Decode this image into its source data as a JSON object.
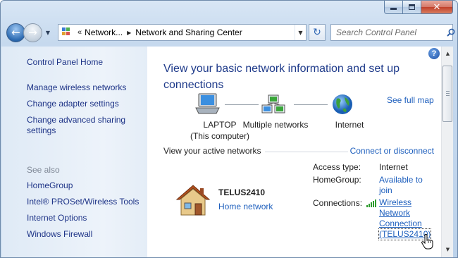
{
  "window": {
    "minimize_glyph": "minimize",
    "maximize_glyph": "maximize",
    "close_glyph": "✕"
  },
  "nav": {
    "back_glyph": "←",
    "forward_glyph": "→",
    "history_glyph": "▼"
  },
  "address": {
    "chevron": "«",
    "segments": [
      "Network...",
      "Network and Sharing Center"
    ],
    "separator": "▶",
    "dropdown": "▼"
  },
  "refresh_glyph": "↻",
  "search": {
    "placeholder": "Search Control Panel"
  },
  "sidebar": {
    "home": "Control Panel Home",
    "tasks": [
      "Manage wireless networks",
      "Change adapter settings",
      "Change advanced sharing settings"
    ],
    "see_also_label": "See also",
    "see_also": [
      "HomeGroup",
      "Intel® PROSet/Wireless Tools",
      "Internet Options",
      "Windows Firewall"
    ]
  },
  "main": {
    "help": "?",
    "heading": "View your basic network information and set up connections",
    "see_full_map": "See full map",
    "nodes": {
      "laptop": {
        "name": "LAPTOP",
        "sub": "(This computer)"
      },
      "multiple": {
        "name": "Multiple networks"
      },
      "internet": {
        "name": "Internet"
      }
    },
    "active_networks_label": "View your active networks",
    "connect_link": "Connect or disconnect",
    "network": {
      "name": "TELUS2410",
      "type": "Home network"
    },
    "props": {
      "access_label": "Access type:",
      "access_value": "Internet",
      "homegroup_label": "HomeGroup:",
      "homegroup_value": "Available to join",
      "connections_label": "Connections:",
      "connection_lines": [
        "Wireless",
        "Network",
        "Connection",
        "(TELUS2410)"
      ]
    }
  },
  "scrollbar": {
    "up": "▲",
    "down": "▼"
  },
  "colors": {
    "link": "#1e5fbd",
    "nav_link": "#1e3487",
    "heading": "#1e3a8a",
    "muted": "#7f8896"
  }
}
